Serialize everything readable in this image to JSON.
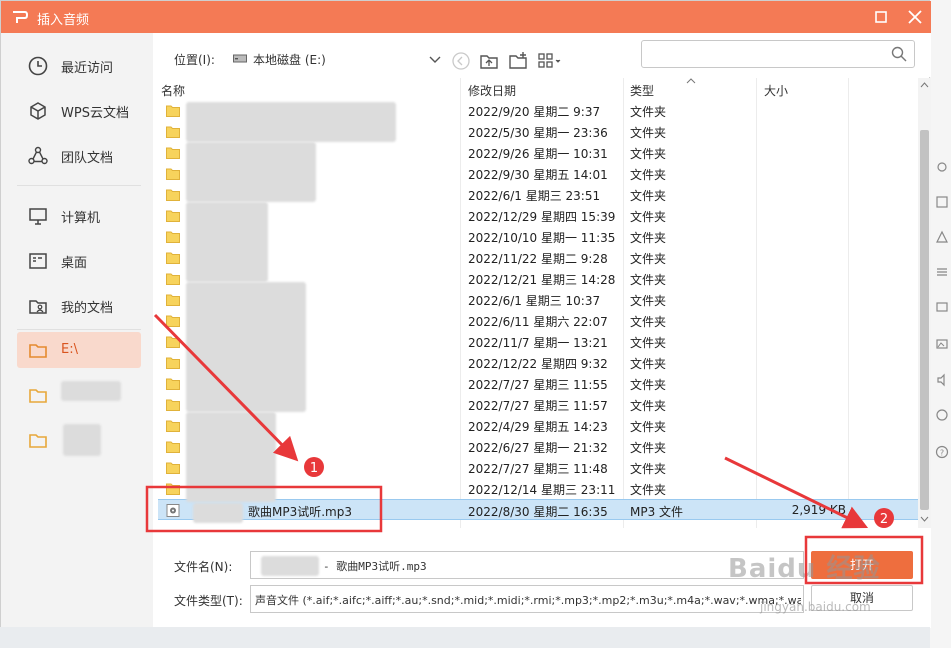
{
  "window": {
    "title": "插入音频",
    "accent_color": "#f47a55",
    "icons": [
      "wps-logo-icon",
      "maximize-icon",
      "close-icon"
    ]
  },
  "sidebar": {
    "items": [
      {
        "label": "最近访问",
        "icon": "clock-icon"
      },
      {
        "label": "WPS云文档",
        "icon": "cube-icon"
      },
      {
        "label": "团队文档",
        "icon": "team-icon"
      },
      {
        "label": "计算机",
        "icon": "monitor-icon"
      },
      {
        "label": "桌面",
        "icon": "desktop-icon"
      },
      {
        "label": "我的文档",
        "icon": "person-folder-icon"
      },
      {
        "label": "E:\\",
        "icon": "folder-icon",
        "active": true
      },
      {
        "label": "",
        "icon": "folder-icon"
      },
      {
        "label": "",
        "icon": "folder-icon"
      }
    ]
  },
  "toolbar": {
    "location_label": "位置(I):",
    "location_value": "本地磁盘 (E:)",
    "search_placeholder": "",
    "icons": [
      "back-icon",
      "up-folder-icon",
      "new-folder-icon",
      "view-grid-icon",
      "search-icon"
    ]
  },
  "filelist": {
    "columns": {
      "name": "名称",
      "date": "修改日期",
      "type": "类型",
      "size": "大小"
    },
    "rows": [
      {
        "date": "2022/9/20 星期二 9:37",
        "type": "文件夹",
        "size": ""
      },
      {
        "date": "2022/5/30 星期一 23:36",
        "type": "文件夹",
        "size": ""
      },
      {
        "date": "2022/9/26 星期一 10:31",
        "type": "文件夹",
        "size": ""
      },
      {
        "date": "2022/9/30 星期五 14:01",
        "type": "文件夹",
        "size": ""
      },
      {
        "date": "2022/6/1 星期三 23:51",
        "type": "文件夹",
        "size": ""
      },
      {
        "date": "2022/12/29 星期四 15:39",
        "type": "文件夹",
        "size": ""
      },
      {
        "date": "2022/10/10 星期一 11:35",
        "type": "文件夹",
        "size": ""
      },
      {
        "date": "2022/11/22 星期二 9:28",
        "type": "文件夹",
        "size": ""
      },
      {
        "date": "2022/12/21 星期三 14:28",
        "type": "文件夹",
        "size": ""
      },
      {
        "date": "2022/6/1 星期三 10:37",
        "type": "文件夹",
        "size": ""
      },
      {
        "date": "2022/6/11 星期六 22:07",
        "type": "文件夹",
        "size": ""
      },
      {
        "date": "2022/11/7 星期一 13:21",
        "type": "文件夹",
        "size": ""
      },
      {
        "date": "2022/12/22 星期四 9:32",
        "type": "文件夹",
        "size": ""
      },
      {
        "date": "2022/7/27 星期三 11:55",
        "type": "文件夹",
        "size": ""
      },
      {
        "date": "2022/7/27 星期三 11:57",
        "type": "文件夹",
        "size": ""
      },
      {
        "date": "2022/4/29 星期五 14:23",
        "type": "文件夹",
        "size": ""
      },
      {
        "date": "2022/6/27 星期一 21:32",
        "type": "文件夹",
        "size": ""
      },
      {
        "date": "2022/7/27 星期三 11:48",
        "type": "文件夹",
        "size": ""
      },
      {
        "date": "2022/12/14 星期三 23:11",
        "type": "文件夹",
        "size": ""
      },
      {
        "name": "歌曲MP3试听.mp3",
        "date": "2022/8/30 星期二 16:35",
        "type": "MP3 文件",
        "size": "2,919 KB",
        "selected": true
      }
    ]
  },
  "bottom": {
    "filename_label": "文件名(N):",
    "filename_value": "- 歌曲MP3试听.mp3",
    "filetype_label": "文件类型(T):",
    "filetype_value": "声音文件 (*.aif;*.aifc;*.aiff;*.au;*.snd;*.mid;*.midi;*.rmi;*.mp3;*.mp2;*.m3u;*.m4a;*.wav;*.wma;*.wax)",
    "open_button": "打开",
    "cancel_button": "取消"
  },
  "annotations": {
    "marker1": "1",
    "marker2": "2",
    "color": "#e8383a"
  },
  "watermark": {
    "text": "Baidu 经验",
    "url": "jingyan.baidu.com"
  }
}
